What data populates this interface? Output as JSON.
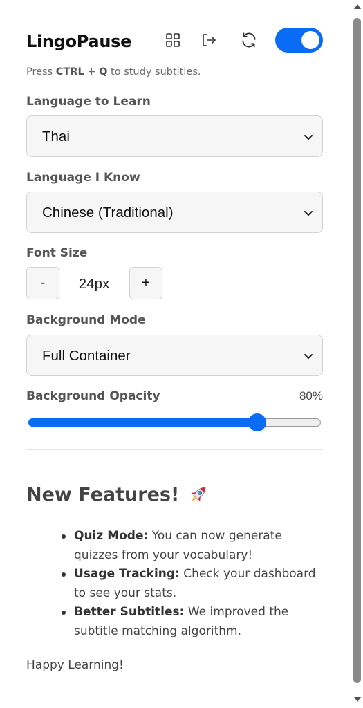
{
  "header": {
    "title": "LingoPause",
    "icons": [
      "dashboard-grid-icon",
      "logout-icon",
      "refresh-icon"
    ],
    "toggle_on": true,
    "accent_color": "#0a6cf5"
  },
  "hint": {
    "prefix": "Press ",
    "key1": "CTRL",
    "plus": " + ",
    "key2": "Q",
    "suffix": " to study subtitles."
  },
  "settings": {
    "learn_label": "Language to Learn",
    "learn_value": "Thai",
    "know_label": "Language I Know",
    "know_value": "Chinese (Traditional)",
    "font_size_label": "Font Size",
    "font_minus": "-",
    "font_size_value": "24px",
    "font_plus": "+",
    "bg_mode_label": "Background Mode",
    "bg_mode_value": "Full Container",
    "opacity_label": "Background Opacity",
    "opacity_value": "80%",
    "opacity_fraction": 0.8
  },
  "new_features": {
    "title": "New Features!",
    "title_icon": "rocket-icon",
    "items": [
      {
        "name": "Quiz Mode:",
        "text": " You can now generate quizzes from your vocabulary!"
      },
      {
        "name": "Usage Tracking:",
        "text": " Check your dashboard to see your stats."
      },
      {
        "name": "Better Subtitles:",
        "text": " We improved the subtitle matching algorithm."
      }
    ]
  },
  "footer": {
    "text": "Happy Learning!"
  }
}
